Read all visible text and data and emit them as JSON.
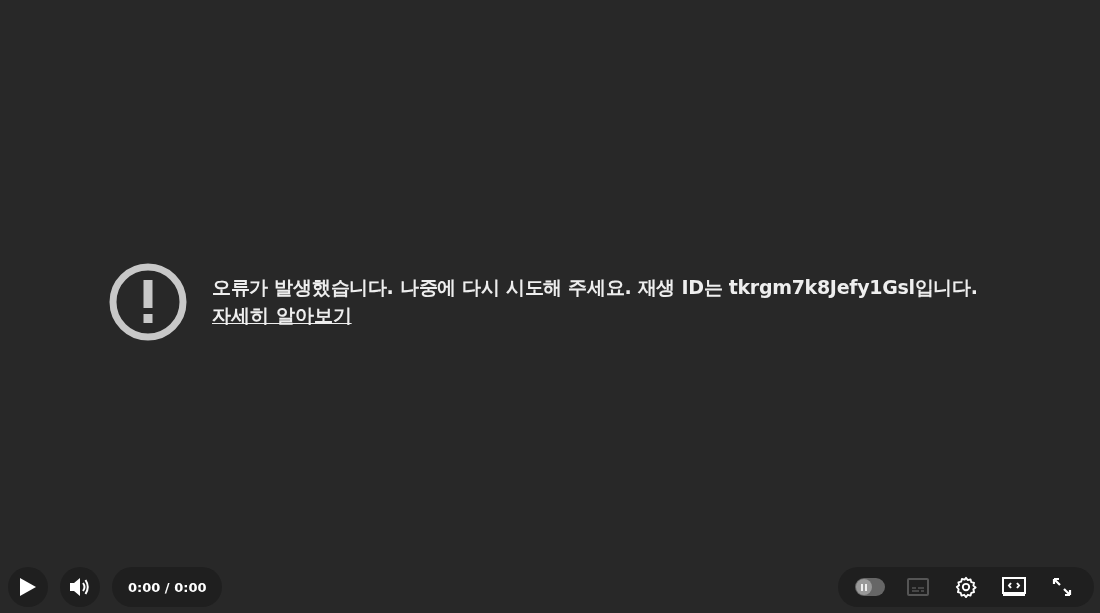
{
  "error": {
    "message": "오류가 발생했습니다. 나중에 다시 시도해 주세요. 재생 ID는 tkrgm7k8Jefy1Gsl입니다.",
    "link": "자세히 알아보기"
  },
  "controls": {
    "time": "0:00 / 0:00",
    "autoplay": {
      "on": false
    },
    "captions": {
      "disabled": true
    }
  }
}
